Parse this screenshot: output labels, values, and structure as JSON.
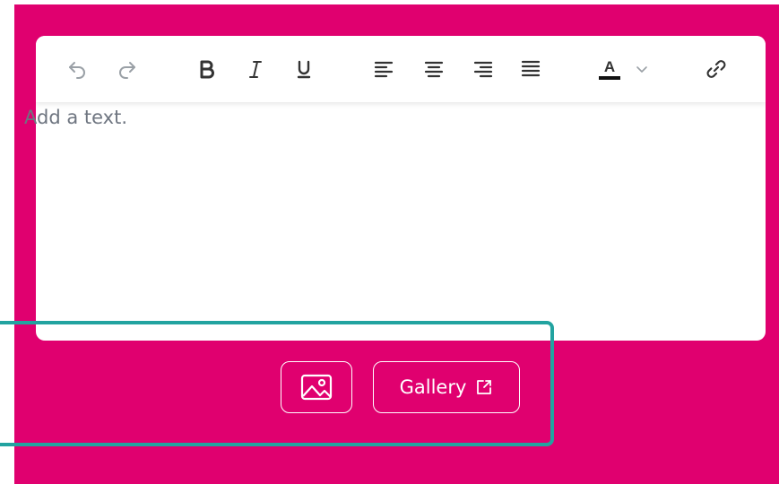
{
  "editor": {
    "placeholder": "Add a text.",
    "toolbar": {
      "icons": [
        "undo-icon",
        "redo-icon",
        "bold-icon",
        "italic-icon",
        "underline-icon",
        "align-left-icon",
        "align-center-icon",
        "align-right-icon",
        "align-justify-icon",
        "text-color-icon",
        "chevron-down-icon",
        "link-icon"
      ],
      "text_color_letter": "A"
    }
  },
  "actions": {
    "image_icon": "image-icon",
    "gallery_label": "Gallery",
    "gallery_icon": "external-link-icon"
  },
  "colors": {
    "panel": "#e0006f",
    "highlight": "#22a3a0",
    "icon": "#333333",
    "icon_disabled": "#9aa0a6"
  }
}
